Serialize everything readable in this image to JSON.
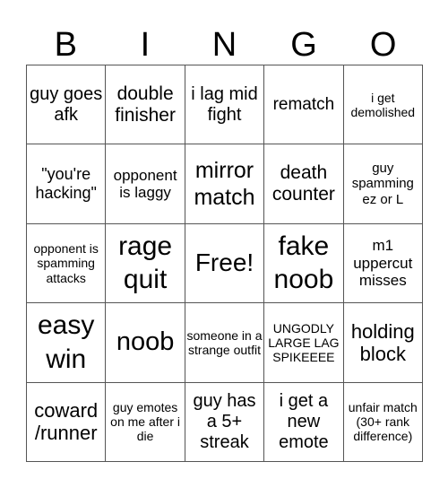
{
  "header": {
    "letters": [
      "B",
      "I",
      "N",
      "G",
      "O"
    ]
  },
  "cells": [
    "guy goes afk",
    "double finisher",
    "i lag mid fight",
    "rematch",
    "i get demolished",
    "\"you're hacking\"",
    "opponent is laggy",
    "mirror match",
    "death counter",
    "guy spamming ez or L",
    "opponent is spamming attacks",
    "rage quit",
    "Free!",
    "fake noob",
    "m1 uppercut misses",
    "easy win",
    "noob",
    "someone in a strange outfit",
    "UNGODLY LARGE LAG SPIKEEEE",
    "holding block",
    "coward /runner",
    "guy emotes on me after i die",
    "guy has a 5+ streak",
    "i get a new emote",
    "unfair match (30+ rank difference)"
  ]
}
